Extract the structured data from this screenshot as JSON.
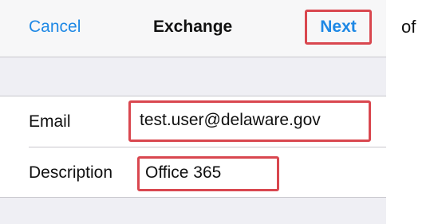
{
  "nav": {
    "cancel_label": "Cancel",
    "title": "Exchange",
    "next_label": "Next"
  },
  "form": {
    "email": {
      "label": "Email",
      "value": "test.user@delaware.gov"
    },
    "description": {
      "label": "Description",
      "value": "Office 365"
    }
  },
  "side_text": "of",
  "colors": {
    "accent": "#1e88e5",
    "highlight_border": "#d9474f",
    "grouped_background": "#efeff4"
  }
}
